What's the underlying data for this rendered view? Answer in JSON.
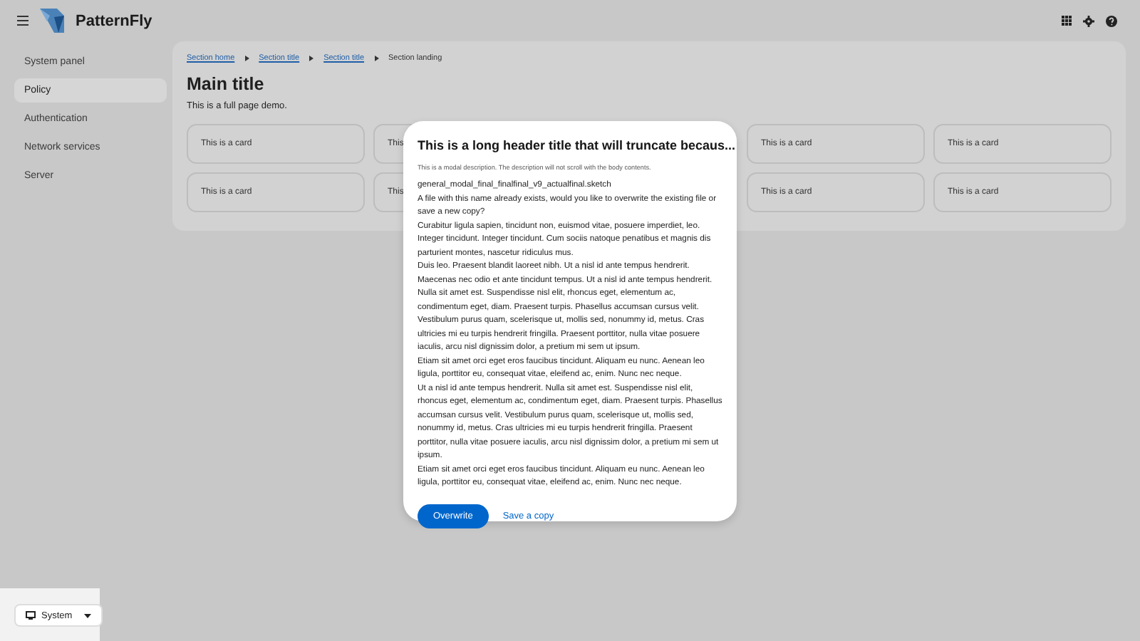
{
  "masthead": {
    "brand": "PatternFly"
  },
  "sidebar": {
    "items": [
      {
        "label": "System panel",
        "selected": false
      },
      {
        "label": "Policy",
        "selected": true
      },
      {
        "label": "Authentication",
        "selected": false
      },
      {
        "label": "Network services",
        "selected": false
      },
      {
        "label": "Server",
        "selected": false
      }
    ]
  },
  "breadcrumb": [
    {
      "label": "Section home",
      "kind": "link"
    },
    {
      "label": "Section title",
      "kind": "link"
    },
    {
      "label": "Section title",
      "kind": "link"
    },
    {
      "label": "Section landing",
      "kind": "current"
    }
  ],
  "page": {
    "title": "Main title",
    "subtitle": "This is a full page demo."
  },
  "cards": [
    {
      "text": "This is a card"
    },
    {
      "text": "This"
    },
    {
      "text": "This is a card"
    },
    {
      "text": "This is a card"
    },
    {
      "text": "This is a card"
    },
    {
      "text": "This"
    },
    {
      "text": "This is a card"
    },
    {
      "text": "This is a card"
    }
  ],
  "theme_switcher": {
    "label": "System"
  },
  "modal": {
    "title": "This is a long header title that will truncate becaus...",
    "description": "This is a modal description. The description will not scroll with the body contents.",
    "paragraphs": [
      "general_modal_final_finalfinal_v9_actualfinal.sketch",
      "A file with this name already exists, would you like to overwrite the existing file or save a new copy?",
      "Curabitur ligula sapien, tincidunt non, euismod vitae, posuere imperdiet, leo. Integer tincidunt. Integer tincidunt. Cum sociis natoque penatibus et magnis dis parturient montes, nascetur ridiculus mus.",
      "Duis leo. Praesent blandit laoreet nibh. Ut a nisl id ante tempus hendrerit. Maecenas nec odio et ante tincidunt tempus. Ut a nisl id ante tempus hendrerit. Nulla sit amet est. Suspendisse nisl elit, rhoncus eget, elementum ac, condimentum eget, diam. Praesent turpis. Phasellus accumsan cursus velit. Vestibulum purus quam, scelerisque ut, mollis sed, nonummy id, metus. Cras ultricies mi eu turpis hendrerit fringilla. Praesent porttitor, nulla vitae posuere iaculis, arcu nisl dignissim dolor, a pretium mi sem ut ipsum.",
      "Etiam sit amet orci eget eros faucibus tincidunt. Aliquam eu nunc. Aenean leo ligula, porttitor eu, consequat vitae, eleifend ac, enim. Nunc nec neque.",
      "Ut a nisl id ante tempus hendrerit. Nulla sit amet est. Suspendisse nisl elit, rhoncus eget, elementum ac, condimentum eget, diam. Praesent turpis. Phasellus accumsan cursus velit. Vestibulum purus quam, scelerisque ut, mollis sed, nonummy id, metus. Cras ultricies mi eu turpis hendrerit fringilla. Praesent porttitor, nulla vitae posuere iaculis, arcu nisl dignissim dolor, a pretium mi sem ut ipsum.",
      "Etiam sit amet orci eget eros faucibus tincidunt. Aliquam eu nunc. Aenean leo ligula, porttitor eu, consequat vitae, eleifend ac, enim. Nunc nec neque."
    ],
    "actions": [
      {
        "label": "Overwrite",
        "kind": "primary"
      },
      {
        "label": "Save a copy",
        "kind": "link"
      }
    ]
  }
}
